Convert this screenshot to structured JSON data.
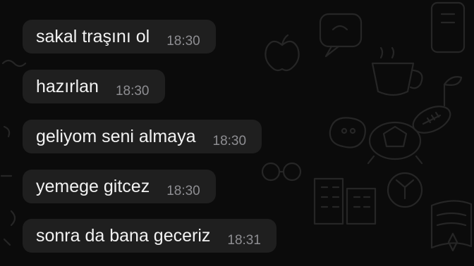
{
  "chat": {
    "messages": [
      {
        "text": "sakal traşını ol",
        "time": "18:30"
      },
      {
        "text": "hazırlan",
        "time": "18:30"
      },
      {
        "text": "geliyom seni almaya",
        "time": "18:30"
      },
      {
        "text": "yemege gitcez",
        "time": "18:30"
      },
      {
        "text": "sonra da bana geceriz",
        "time": "18:31"
      }
    ]
  },
  "colors": {
    "background": "#0b0b0b",
    "bubble": "#1f1f1f",
    "text": "#f2f2f2",
    "timestamp": "#8e8e92",
    "doodle": "#262626"
  }
}
